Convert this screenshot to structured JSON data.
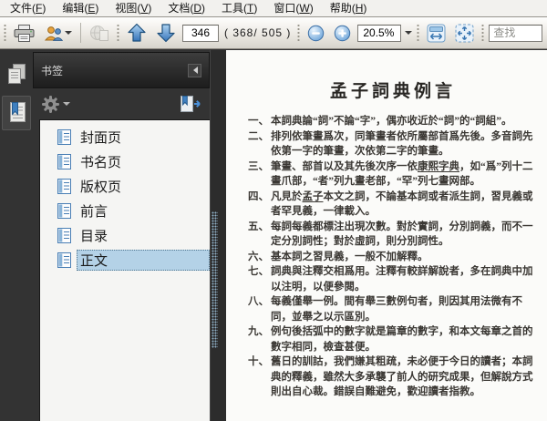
{
  "menubar": {
    "items": [
      {
        "label": "文件(⟨F⟩)"
      },
      {
        "label": "编辑(⟨E⟩)"
      },
      {
        "label": "视图(⟨V⟩)"
      },
      {
        "label": "文档(⟨D⟩)"
      },
      {
        "label": "工具(⟨T⟩)"
      },
      {
        "label": "窗口(⟨W⟩)"
      },
      {
        "label": "帮助(⟨H⟩)"
      }
    ]
  },
  "toolbar": {
    "page_number_value": "346",
    "page_count_text": "( 368/ 505 )",
    "zoom_value": "20.5%",
    "find_placeholder": "查找",
    "accent_blue": "#3c7cc0",
    "icons": {
      "print": "printer-icon",
      "contacts": "contacts-icon",
      "share_disabled": "globe-document-icon",
      "previous_page": "arrow-up-icon",
      "next_page": "arrow-down-icon",
      "zoom_out": "minus-circle-icon",
      "zoom_in": "plus-circle-icon",
      "fit_width": "fit-width-icon",
      "fit_page": "fit-page-icon"
    }
  },
  "sidebar": {
    "panel_title": "书签",
    "selected_color": "#b4d2e7",
    "bookmarks": [
      {
        "label": "封面页",
        "selected": false
      },
      {
        "label": "书名页",
        "selected": false
      },
      {
        "label": "版权页",
        "selected": false
      },
      {
        "label": "前言",
        "selected": false
      },
      {
        "label": "目录",
        "selected": false
      },
      {
        "label": "正文",
        "selected": true
      }
    ]
  },
  "document": {
    "title": "孟子詞典例言",
    "items": [
      {
        "num": "一、",
        "text": "本詞典論“詞”不論“字”，偶亦收近於“詞”的“詞組”。"
      },
      {
        "num": "二、",
        "text": "排列依筆畫爲次，同筆畫者依所屬部首爲先後。多音詞先依第一字的筆畫，次依第二字的筆畫。"
      },
      {
        "num": "三、",
        "text": "筆畫、部首以及其先後次序一依⟨康熙字典⟩，如“爲”列十二畫爪部，“者”列九畫老部，“罕”列七畫网部。"
      },
      {
        "num": "四、",
        "text": "凡見於⟨孟子⟩本文之詞，不論基本詞或者派生詞，習見義或者罕見義，一律載入。"
      },
      {
        "num": "五、",
        "text": "每詞每義都標注出現次數。對於實詞，分別詞義，而不一定分別詞性；對於虛詞，則分別詞性。"
      },
      {
        "num": "六、",
        "text": "基本詞之習見義，一般不加解釋。"
      },
      {
        "num": "七、",
        "text": "詞典與注釋交相爲用。注釋有較詳解說者，多在詞典中加以注明，以便參閱。"
      },
      {
        "num": "八、",
        "text": "每義僅舉一例。間有舉三數例句者，則因其用法微有不同，並舉之以示區別。"
      },
      {
        "num": "九、",
        "text": "例句後括弧中的數字就是篇章的數字，和本文每章之首的數字相同，檢查甚便。"
      },
      {
        "num": "十、",
        "text": "舊日的訓詁，我們嫌其粗疏，未必便于今日的讀者；本詞典的釋義，雖然大多承襲了前人的研究成果，但解說方式則出自心裁。錯誤自難避免，歡迎讀者指教。"
      }
    ]
  }
}
